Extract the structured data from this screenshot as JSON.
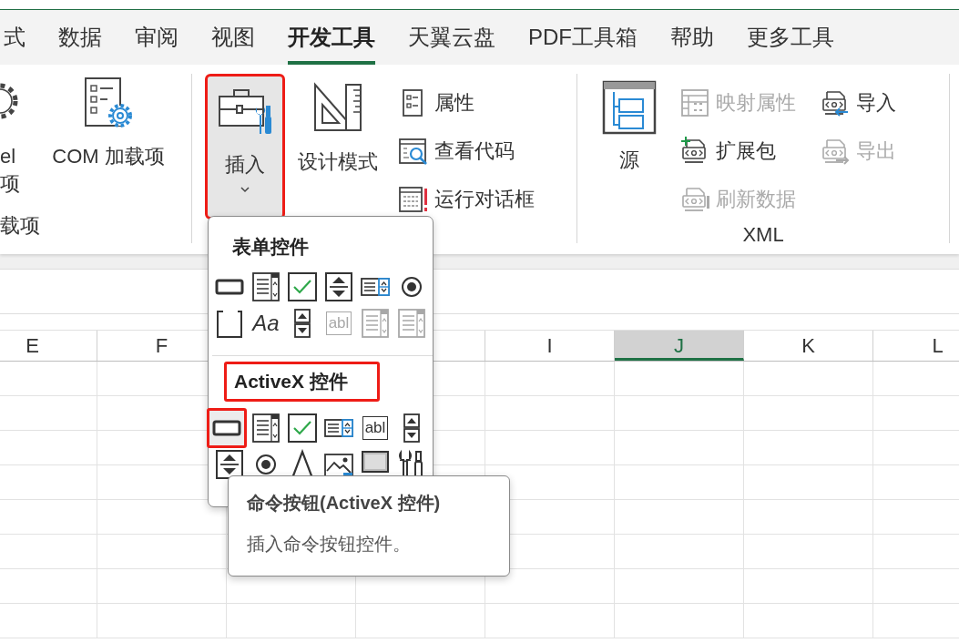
{
  "tabs": [
    {
      "label": "式",
      "selected": false
    },
    {
      "label": "数据",
      "selected": false
    },
    {
      "label": "审阅",
      "selected": false
    },
    {
      "label": "视图",
      "selected": false
    },
    {
      "label": "开发工具",
      "selected": true
    },
    {
      "label": "天翼云盘",
      "selected": false
    },
    {
      "label": "PDF工具箱",
      "selected": false
    },
    {
      "label": "帮助",
      "selected": false
    },
    {
      "label": "更多工具",
      "selected": false
    }
  ],
  "groups": [
    {
      "label": "载项",
      "large": [
        {
          "kind": "addins",
          "lines": [
            "el",
            "项"
          ]
        },
        {
          "kind": "com",
          "lines": [
            "COM 加载项"
          ]
        }
      ]
    },
    {
      "large": [
        {
          "kind": "insert",
          "lines": [
            "插入"
          ],
          "pressed": true,
          "highlighted": true
        },
        {
          "kind": "design",
          "lines": [
            "设计模式"
          ]
        }
      ],
      "columns": [
        [
          {
            "kind": "properties",
            "label": "属性",
            "disabled": false
          },
          {
            "kind": "code",
            "label": "查看代码",
            "disabled": false
          },
          {
            "kind": "dialog",
            "label": "运行对话框",
            "disabled": false
          }
        ]
      ]
    },
    {
      "label": "XML",
      "large": [
        {
          "kind": "source",
          "lines": [
            "源"
          ]
        }
      ],
      "columns": [
        [
          {
            "kind": "map",
            "label": "映射属性",
            "disabled": true
          },
          {
            "kind": "pack",
            "label": "扩展包",
            "disabled": false
          },
          {
            "kind": "refresh",
            "label": "刷新数据",
            "disabled": true
          }
        ],
        [
          {
            "kind": "import",
            "label": "导入",
            "disabled": false
          },
          {
            "kind": "export",
            "label": "导出",
            "disabled": true
          }
        ]
      ]
    }
  ],
  "dropdown": {
    "sections": [
      {
        "title": "表单控件",
        "highlighted": false,
        "controls": [
          {
            "kind": "button",
            "disabled": false,
            "highlighted": false
          },
          {
            "kind": "combo",
            "disabled": false,
            "highlighted": false
          },
          {
            "kind": "check",
            "disabled": false
          },
          {
            "kind": "spin",
            "disabled": false,
            "highlighted": false
          },
          {
            "kind": "listbox",
            "disabled": false,
            "highlighted": false
          },
          {
            "kind": "option",
            "disabled": false,
            "highlighted": false
          },
          {
            "kind": "groupbox",
            "disabled": false,
            "highlighted": false
          },
          {
            "kind": "label",
            "glyph": "Aa",
            "disabled": false,
            "highlighted": false
          },
          {
            "kind": "scroll",
            "disabled": false,
            "highlighted": false
          },
          {
            "kind": "textbox",
            "glyph": "abl",
            "disabled": true,
            "highlighted": false
          },
          {
            "kind": "combo",
            "disabled": true,
            "highlighted": false
          },
          {
            "kind": "combo",
            "disabled": true,
            "highlighted": false
          }
        ]
      },
      {
        "title": "ActiveX 控件",
        "highlighted": true,
        "controls": [
          {
            "kind": "button",
            "disabled": false,
            "highlighted": true
          },
          {
            "kind": "combo",
            "disabled": false,
            "highlighted": false
          },
          {
            "kind": "check",
            "disabled": false
          },
          {
            "kind": "listbox",
            "disabled": false,
            "highlighted": false
          },
          {
            "kind": "textbox",
            "glyph": "abl",
            "disabled": false,
            "highlighted": false
          },
          {
            "kind": "scroll",
            "disabled": false,
            "highlighted": false
          },
          {
            "kind": "spin",
            "disabled": false,
            "highlighted": false
          },
          {
            "kind": "option",
            "disabled": false,
            "highlighted": false
          },
          {
            "kind": "letter",
            "disabled": false,
            "highlighted": false
          },
          {
            "kind": "image",
            "disabled": false,
            "highlighted": false
          },
          {
            "kind": "toggle",
            "disabled": false,
            "highlighted": false
          },
          {
            "kind": "more",
            "disabled": false,
            "highlighted": false
          }
        ]
      }
    ]
  },
  "tooltip": {
    "title": "命令按钮(ActiveX 控件)",
    "description": "插入命令按钮控件。"
  },
  "sheet": {
    "columns": [
      {
        "label": "E",
        "selected": false
      },
      {
        "label": "F",
        "selected": false
      },
      {
        "label": "I",
        "selected": false
      },
      {
        "label": "J",
        "selected": true
      },
      {
        "label": "K",
        "selected": false
      },
      {
        "label": "L",
        "selected": false
      }
    ]
  }
}
